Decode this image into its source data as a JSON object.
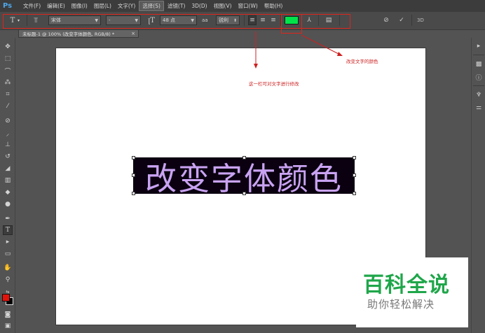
{
  "app": {
    "logo": "Ps"
  },
  "menu": [
    {
      "label": "文件(F)"
    },
    {
      "label": "编辑(E)"
    },
    {
      "label": "图像(I)"
    },
    {
      "label": "图层(L)"
    },
    {
      "label": "文字(Y)"
    },
    {
      "label": "选择(S)"
    },
    {
      "label": "滤镜(T)"
    },
    {
      "label": "3D(D)"
    },
    {
      "label": "视图(V)"
    },
    {
      "label": "窗口(W)"
    },
    {
      "label": "帮助(H)"
    }
  ],
  "options": {
    "font_family": "宋体",
    "font_style": "-",
    "font_size": "48 点",
    "antialias_label": "aa",
    "antialias": "锐利",
    "text_color": "#00e44a",
    "commit_label": "3D"
  },
  "document": {
    "tab_title": "未标题-1 @ 100% (改变字体颜色, RGB/8) *",
    "close_glyph": "×"
  },
  "canvas": {
    "text": "改变字体颜色",
    "text_color": "#c9a3f2",
    "highlight": "#0a0010"
  },
  "annotations": {
    "color_note": "改变文字的颜色",
    "bar_note": "这一栏可对文字进行修改"
  },
  "colors": {
    "foreground": "#e3120b",
    "background": "#000000",
    "frame": "#e0241b"
  },
  "watermark": {
    "title": "百科全说",
    "subtitle": "助你轻松解决"
  }
}
